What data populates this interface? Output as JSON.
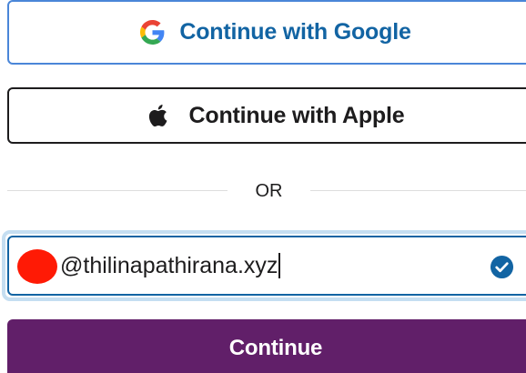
{
  "google_button": {
    "label": "Continue with Google",
    "icon": "google-logo-icon"
  },
  "apple_button": {
    "label": "Continue with Apple",
    "icon": "apple-logo-icon"
  },
  "divider": {
    "label": "OR"
  },
  "email_input": {
    "value": "@thilinapathirana.xyz",
    "status_icon": "check-circle-icon"
  },
  "continue_button": {
    "label": "Continue"
  },
  "colors": {
    "google_text": "#1264a3",
    "google_border": "#4a86d8",
    "apple_border": "#1d1c1d",
    "input_focus_border": "#1264a3",
    "input_focus_ring": "#c5def1",
    "check_fill": "#1264a3",
    "primary_button": "#611f69",
    "redaction_mark": "#ff1a05"
  }
}
